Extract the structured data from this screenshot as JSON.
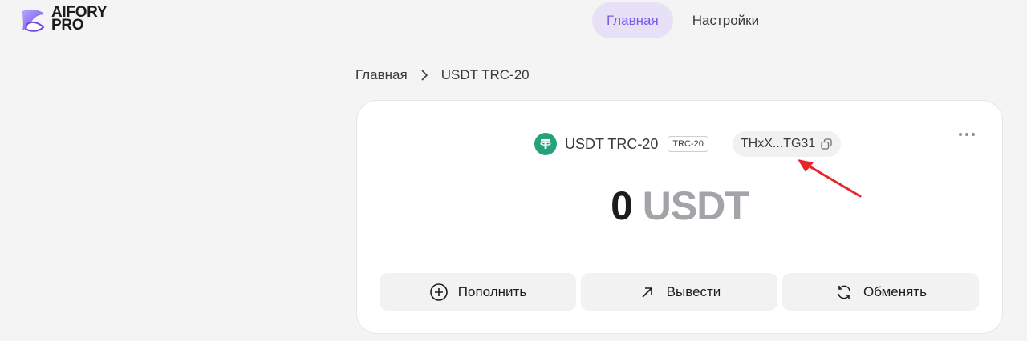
{
  "brand": {
    "line1": "AIFORY",
    "line2": "PRO"
  },
  "nav": {
    "tabs": [
      {
        "label": "Главная",
        "active": true
      },
      {
        "label": "Настройки",
        "active": false
      }
    ]
  },
  "breadcrumb": {
    "home": "Главная",
    "current": "USDT TRC-20"
  },
  "asset": {
    "icon": "tether-icon",
    "name": "USDT TRC-20",
    "network_badge": "TRC-20",
    "address_short": "THxX...TG31"
  },
  "balance": {
    "amount": "0",
    "unit": "USDT"
  },
  "actions": {
    "deposit": "Пополнить",
    "withdraw": "Вывести",
    "exchange": "Обменять"
  },
  "colors": {
    "accent": "#7a5be8",
    "accent_bg": "#e7e1f8",
    "tether": "#26a17b",
    "annotation": "#e8262a"
  }
}
